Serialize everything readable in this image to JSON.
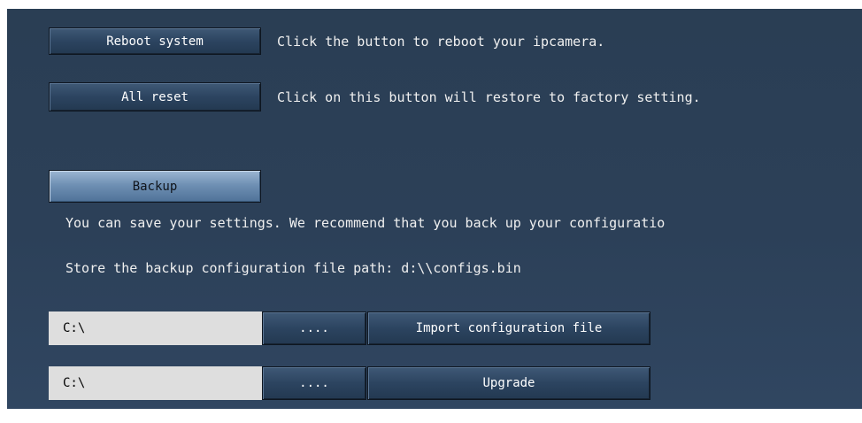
{
  "reboot": {
    "button_label": "Reboot system",
    "description": "Click the button to reboot your ipcamera."
  },
  "reset": {
    "button_label": "All reset",
    "description": "Click on this button will restore to factory setting."
  },
  "backup": {
    "button_label": "Backup",
    "description": "You can save your settings. We recommend that you back up your configuratio",
    "path_text": "Store the backup configuration file path: d:\\\\configs.bin"
  },
  "import": {
    "path_value": "C:\\",
    "browse_label": "....",
    "button_label": "Import configuration file"
  },
  "upgrade": {
    "path_value": "C:\\",
    "browse_label": "....",
    "button_label": "Upgrade"
  }
}
